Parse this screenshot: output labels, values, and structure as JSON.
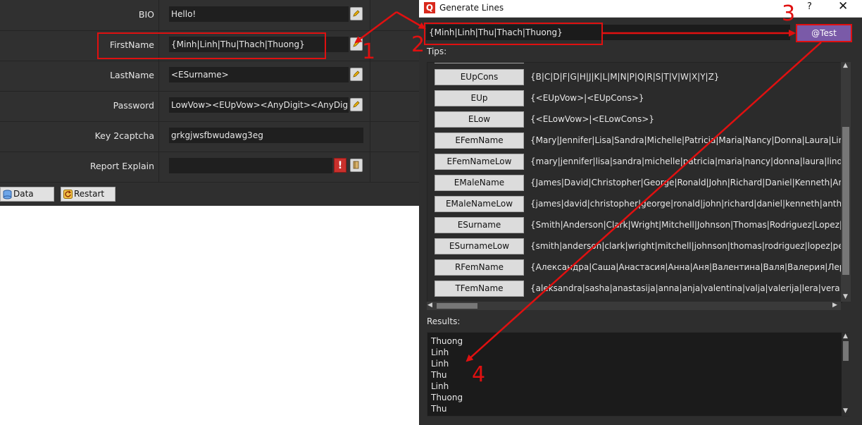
{
  "form": {
    "rows": [
      {
        "label": "BIO",
        "value": "Hello!"
      },
      {
        "label": "FirstName",
        "value": "{Minh|Linh|Thu|Thach|Thuong}"
      },
      {
        "label": "LastName",
        "value": "<ESurname>"
      },
      {
        "label": "Password",
        "value": "LowVow><EUpVow><AnyDigit><AnyDigit>"
      },
      {
        "label": "Key 2captcha",
        "value": "grkgjwsfbwudawg3eg"
      },
      {
        "label": "Report Explain",
        "value": ""
      }
    ],
    "warning_glyph": "!",
    "buttons": {
      "data": "Data",
      "restart": "Restart"
    }
  },
  "dialog": {
    "title": "Generate Lines",
    "help": "?",
    "close": "✕",
    "logo": "Q",
    "template_input": "{Minh|Linh|Thu|Thach|Thuong}",
    "test_button": "@Test",
    "tips_label": "Tips:",
    "tips": [
      {
        "name": "EUpCons",
        "value": "{B|C|D|F|G|H|J|K|L|M|N|P|Q|R|S|T|V|W|X|Y|Z}"
      },
      {
        "name": "EUp",
        "value": "{<EUpVow>|<EUpCons>}"
      },
      {
        "name": "ELow",
        "value": "{<ELowVow>|<ELowCons>}"
      },
      {
        "name": "EFemName",
        "value": "{Mary|Jennifer|Lisa|Sandra|Michelle|Patricia|Maria|Nancy|Donna|Laura|Linda"
      },
      {
        "name": "EFemNameLow",
        "value": "{mary|jennifer|lisa|sandra|michelle|patricia|maria|nancy|donna|laura|linda"
      },
      {
        "name": "EMaleName",
        "value": "{James|David|Christopher|George|Ronald|John|Richard|Daniel|Kenneth|Anth"
      },
      {
        "name": "EMaleNameLow",
        "value": "{james|david|christopher|george|ronald|john|richard|daniel|kenneth|anthon"
      },
      {
        "name": "ESurname",
        "value": "{Smith|Anderson|Clark|Wright|Mitchell|Johnson|Thomas|Rodriguez|Lopez|P"
      },
      {
        "name": "ESurnameLow",
        "value": "{smith|anderson|clark|wright|mitchell|johnson|thomas|rodriguez|lopez|pere"
      },
      {
        "name": "RFemName",
        "value": "{Александра|Саша|Анастасия|Анна|Аня|Валентина|Валя|Валерия|Лера|"
      },
      {
        "name": "TFemName",
        "value": "{aleksandra|sasha|anastasija|anna|anja|valentina|valja|valerija|lera|vera|v"
      }
    ],
    "results_label": "Results:",
    "results": [
      "Thuong",
      "Linh",
      "Linh",
      "Thu",
      "Linh",
      "Thuong",
      "Thu"
    ]
  },
  "annotations": {
    "one": "1",
    "two": "2",
    "three": "3",
    "four": "4",
    "color": "#e01010"
  }
}
